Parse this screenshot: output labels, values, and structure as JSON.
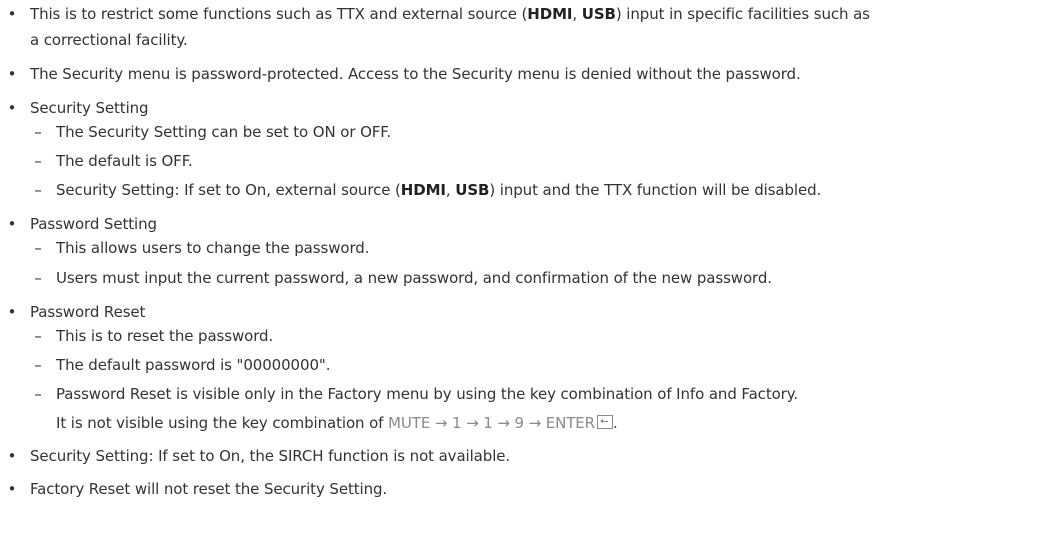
{
  "items": {
    "restrict": {
      "part1": "This is to restrict some functions such as TTX and external source (",
      "hdmi": "HDMI",
      "comma": ", ",
      "usb": "USB",
      "part2": ") input in specific facilities such as",
      "line2": "a correctional facility."
    },
    "protected": "The Security menu is password-protected. Access to the Security menu is denied without the password.",
    "security_setting": {
      "label": "Security Setting",
      "sub1": "The Security Setting can be set to ON or OFF.",
      "sub2": "The default is OFF.",
      "sub3_part1": "Security Setting: If set to On, external source (",
      "sub3_hdmi": "HDMI",
      "sub3_comma": ", ",
      "sub3_usb": "USB",
      "sub3_part2": ") input and the TTX function will be disabled."
    },
    "password_setting": {
      "label": "Password Setting",
      "sub1": "This allows users to change the password.",
      "sub2": "Users must input the current password, a new password, and confirmation of the new password."
    },
    "password_reset": {
      "label": "Password Reset",
      "sub1": "This is to reset the password.",
      "sub2": "The default password is \"00000000\".",
      "sub3": "Password Reset is visible only in the Factory menu by using the key combination of Info and Factory.",
      "sub3_cont": "It is not visible using the key combination of ",
      "keys": "MUTE → 1 → 1 → 9 → ENTER",
      "period": "."
    },
    "sirch": "Security Setting: If set to On, the SIRCH function is not available.",
    "factory_reset": "Factory Reset will not reset the Security Setting."
  },
  "glyphs": {
    "bullet": "•",
    "dash": "–"
  },
  "icons": {
    "enter": "enter-icon"
  }
}
